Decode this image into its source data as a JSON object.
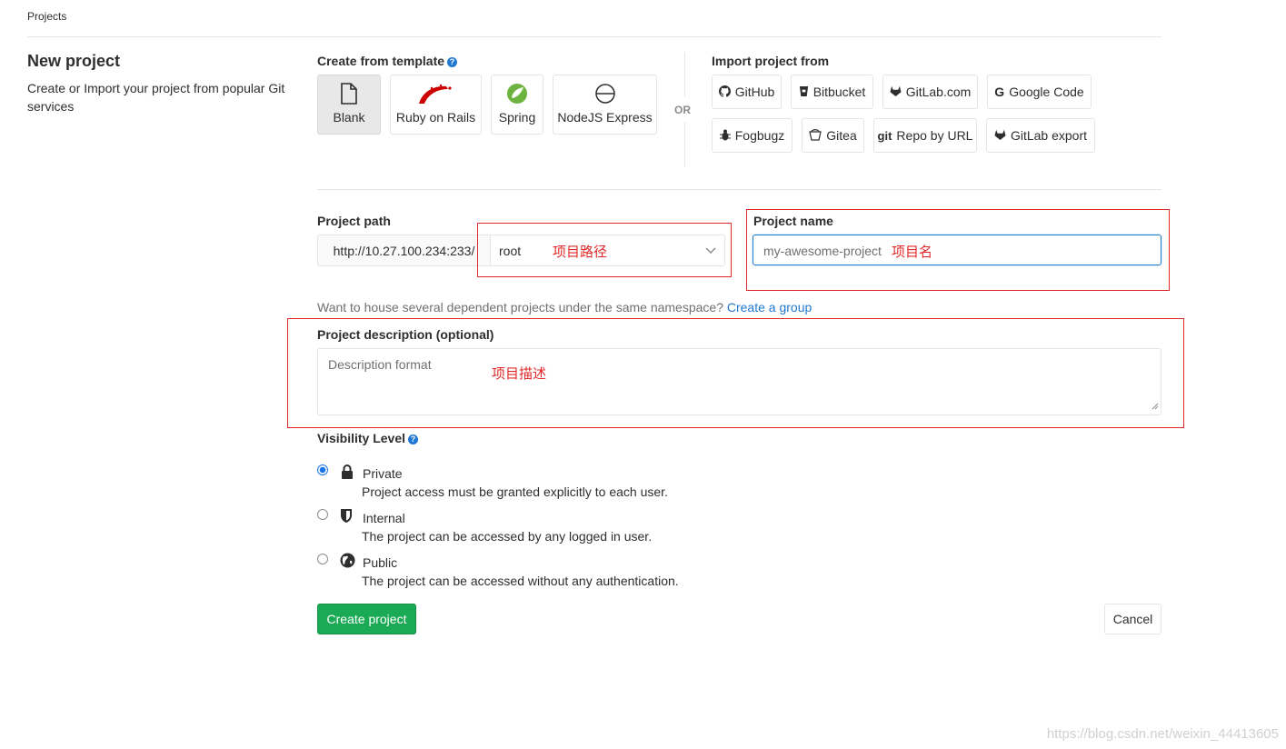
{
  "breadcrumb": "Projects",
  "page": {
    "title": "New project",
    "subtitle": "Create or Import your project from popular Git services"
  },
  "template": {
    "heading": "Create from template",
    "items": [
      {
        "label": "Blank",
        "icon": "file-icon",
        "active": true
      },
      {
        "label": "Ruby on Rails",
        "icon": "rails-logo-icon",
        "active": false
      },
      {
        "label": "Spring",
        "icon": "spring-logo-icon",
        "active": false
      },
      {
        "label": "NodeJS Express",
        "icon": "express-logo-icon",
        "active": false
      }
    ],
    "or": "OR"
  },
  "import": {
    "heading": "Import project from",
    "items": [
      {
        "label": "GitHub",
        "icon": "github-icon"
      },
      {
        "label": "Bitbucket",
        "icon": "bitbucket-icon"
      },
      {
        "label": "GitLab.com",
        "icon": "gitlab-icon"
      },
      {
        "label": "Google Code",
        "icon": "google-icon"
      },
      {
        "label": "Fogbugz",
        "icon": "bug-icon"
      },
      {
        "label": "Gitea",
        "icon": "gitea-icon"
      },
      {
        "label": "Repo by URL",
        "icon": "git-icon"
      },
      {
        "label": "GitLab export",
        "icon": "gitlab-icon"
      }
    ]
  },
  "project_path": {
    "label": "Project path",
    "prefix": "http://10.27.100.234:233/",
    "namespace": "root",
    "annotation": "项目路径"
  },
  "project_name": {
    "label": "Project name",
    "value": "my-awesome-project",
    "annotation": "项目名"
  },
  "group_hint": {
    "text": "Want to house several dependent projects under the same namespace?",
    "link": "Create a group"
  },
  "description": {
    "label": "Project description (optional)",
    "placeholder": "Description format",
    "annotation": "项目描述"
  },
  "visibility": {
    "label": "Visibility Level",
    "options": [
      {
        "title": "Private",
        "desc": "Project access must be granted explicitly to each user.",
        "icon": "lock-icon",
        "checked": true
      },
      {
        "title": "Internal",
        "desc": "The project can be accessed by any logged in user.",
        "icon": "shield-icon",
        "checked": false
      },
      {
        "title": "Public",
        "desc": "The project can be accessed without any authentication.",
        "icon": "globe-icon",
        "checked": false
      }
    ]
  },
  "actions": {
    "create": "Create project",
    "cancel": "Cancel"
  },
  "watermark": "https://blog.csdn.net/weixin_44413605",
  "colors": {
    "primary_blue": "#1f78d1",
    "success_green": "#1aaa55",
    "annotation_red": "#e0282a"
  }
}
